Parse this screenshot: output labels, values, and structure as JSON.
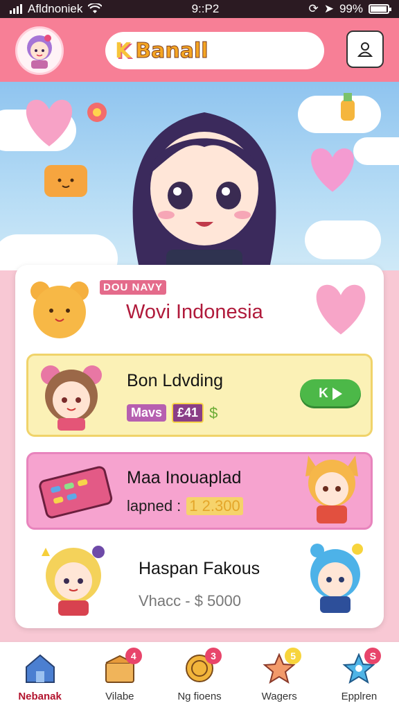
{
  "status_bar": {
    "carrier": "Afldnoniek",
    "time": "9::P2",
    "battery": "99%"
  },
  "header": {
    "logo_mark": "K",
    "app_title": "Banall"
  },
  "card": {
    "tag": "DOU NAVY",
    "heading": "Wovi Indonesia",
    "items": [
      {
        "title": "Bon Ldvding",
        "meta_label": "Mavs",
        "meta_value": "£41",
        "meta_currency": "$",
        "action_label": "K"
      },
      {
        "title": "Maa Inouaplad",
        "sub_label": "lapned :",
        "sub_value": "1 2.300"
      },
      {
        "title": "Haspan Fakous",
        "sub_label": "Vhacc - $ 5000"
      }
    ]
  },
  "nav": {
    "items": [
      {
        "label": "Nebanak",
        "badge": ""
      },
      {
        "label": "Vilabe",
        "badge": "4"
      },
      {
        "label": "Ng fioens",
        "badge": "3"
      },
      {
        "label": "Wagers",
        "badge": "5"
      },
      {
        "label": "Epplren",
        "badge": "S"
      }
    ]
  },
  "colors": {
    "header": "#f77f96",
    "accent": "#b01a3b",
    "play_button": "#4cb848"
  }
}
